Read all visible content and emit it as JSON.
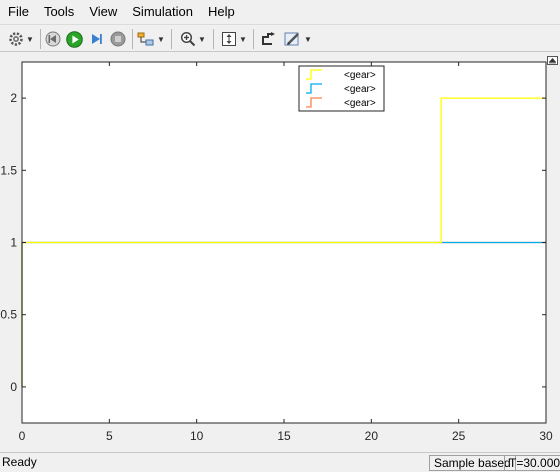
{
  "menu": [
    "File",
    "Tools",
    "View",
    "Simulation",
    "Help"
  ],
  "status": {
    "left": "Ready",
    "mode": "Sample based",
    "time": "T=30.000"
  },
  "chart_data": {
    "type": "line",
    "title": "",
    "xlabel": "",
    "ylabel": "",
    "xlim": [
      0,
      30
    ],
    "ylim": [
      -0.25,
      2.25
    ],
    "xticks": [
      0,
      5,
      10,
      15,
      20,
      25,
      30
    ],
    "yticks": [
      0,
      0.5,
      1,
      1.5,
      2
    ],
    "ytick_labels": [
      "0",
      "0.5",
      "1",
      "1.5",
      "2"
    ],
    "grid": false,
    "legend_position": "top-center",
    "series": [
      {
        "name": "<gear>",
        "color": "#ffff00",
        "step": true,
        "x": [
          0,
          0,
          24,
          24,
          30
        ],
        "y": [
          0,
          1,
          1,
          2,
          2
        ]
      },
      {
        "name": "<gear>",
        "color": "#00aeef",
        "step": true,
        "x": [
          0,
          0,
          30
        ],
        "y": [
          0,
          1,
          1
        ]
      },
      {
        "name": "<gear>",
        "color": "#ff7f50",
        "step": true,
        "x": [
          0,
          0,
          30
        ],
        "y": [
          0,
          1,
          1
        ]
      }
    ]
  }
}
